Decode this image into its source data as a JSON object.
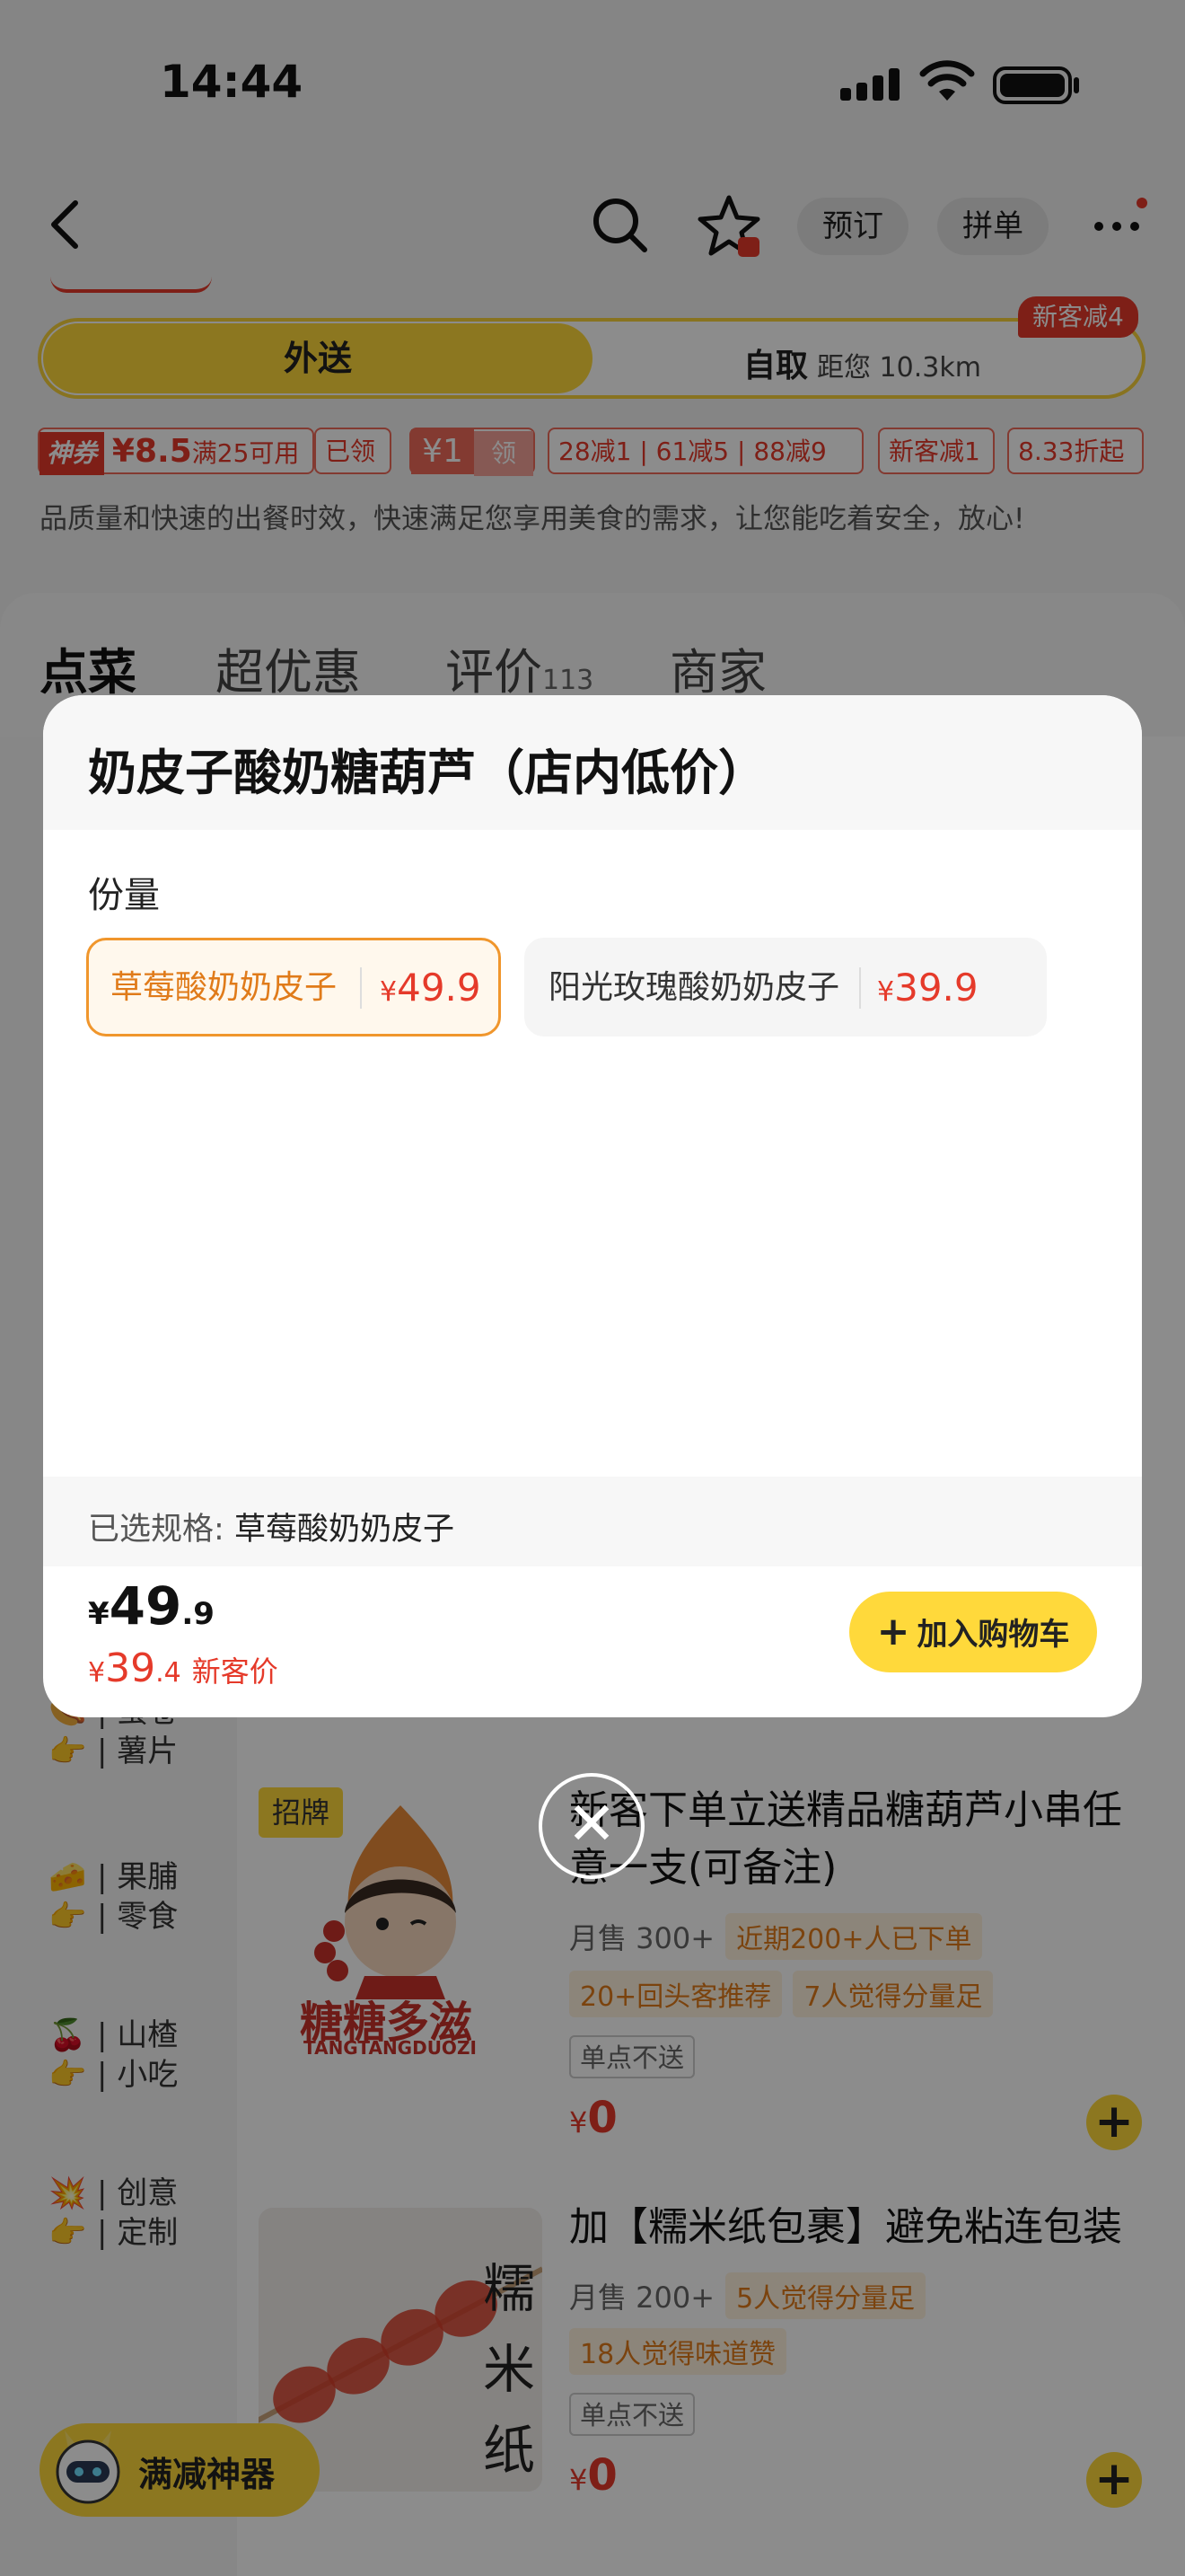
{
  "status_bar": {
    "time": "14:44"
  },
  "nav": {
    "back_icon": "back-arrow-icon",
    "reserve_label": "预订",
    "group_label": "拼单"
  },
  "delivery": {
    "delivery_label": "外送",
    "pickup_label": "自取",
    "distance": "距您 10.3km",
    "new_customer_badge": "新客减4"
  },
  "promos": {
    "coupon_tag": "神券",
    "coupon_value": "¥8.5",
    "coupon_cond": "满25可用",
    "coupon_status": "已领",
    "yuan1": "¥1",
    "yuan1_action": "领",
    "tiers": "28减1 | 61减5 | 88减9",
    "new_reduce": "新客减1",
    "discount": "8.33折起"
  },
  "store_desc": "品质量和快速的出餐时效，快速满足您享用美食的需求，让您能吃着安全，放心!",
  "tabs": [
    {
      "label": "点菜"
    },
    {
      "label": "超优惠"
    },
    {
      "label": "评价",
      "count": "113"
    },
    {
      "label": "商家"
    }
  ],
  "sidebar": {
    "items": [
      {
        "icon": "🌭",
        "label": "蛋卷\n薯片"
      },
      {
        "icon": "🧀",
        "label": "果脯\n零食"
      },
      {
        "icon": "🍒",
        "label": "山楂\n小吃"
      },
      {
        "icon": "💥",
        "label": "创意\n定制"
      }
    ]
  },
  "items": [
    {
      "badge": "招牌",
      "logo_text": "糖糖多滋",
      "logo_sub": "TANGTANGDUOZI",
      "title": "新客下单立送精品糖葫芦小串任意一支(可备注)",
      "sales": "月售 300+",
      "tag1": "近期200+人已下单",
      "tag2": "20+回头客推荐",
      "tag3": "7人觉得分量足",
      "note": "单点不送",
      "currency": "¥",
      "price": "0"
    },
    {
      "title": "加【糯米纸包裹】避免粘连包装",
      "sales": "月售 200+",
      "tag1": "5人觉得分量足",
      "tag2": "18人觉得味道赞",
      "note": "单点不送",
      "currency": "¥",
      "price": "0"
    }
  ],
  "floating": {
    "label": "满减神器"
  },
  "modal": {
    "title": "奶皮子酸奶糖葫芦（店内低价）",
    "section": "份量",
    "options": [
      {
        "name": "草莓酸奶奶皮子",
        "currency": "¥",
        "price": "49.9",
        "selected": true
      },
      {
        "name": "阳光玫瑰酸奶奶皮子",
        "currency": "¥",
        "price": "39.9",
        "selected": false
      }
    ],
    "selected_label": "已选规格:",
    "selected_value": "草莓酸奶奶皮子",
    "price_currency": "¥",
    "price_int": "49",
    "price_dec": ".9",
    "new_currency": "¥",
    "new_int": "39",
    "new_dec": ".4",
    "new_tag": "新客价",
    "add_label": "加入购物车"
  },
  "colors": {
    "accent": "#ffd93b",
    "price": "#e53a2a",
    "selected_border": "#f0962c"
  }
}
